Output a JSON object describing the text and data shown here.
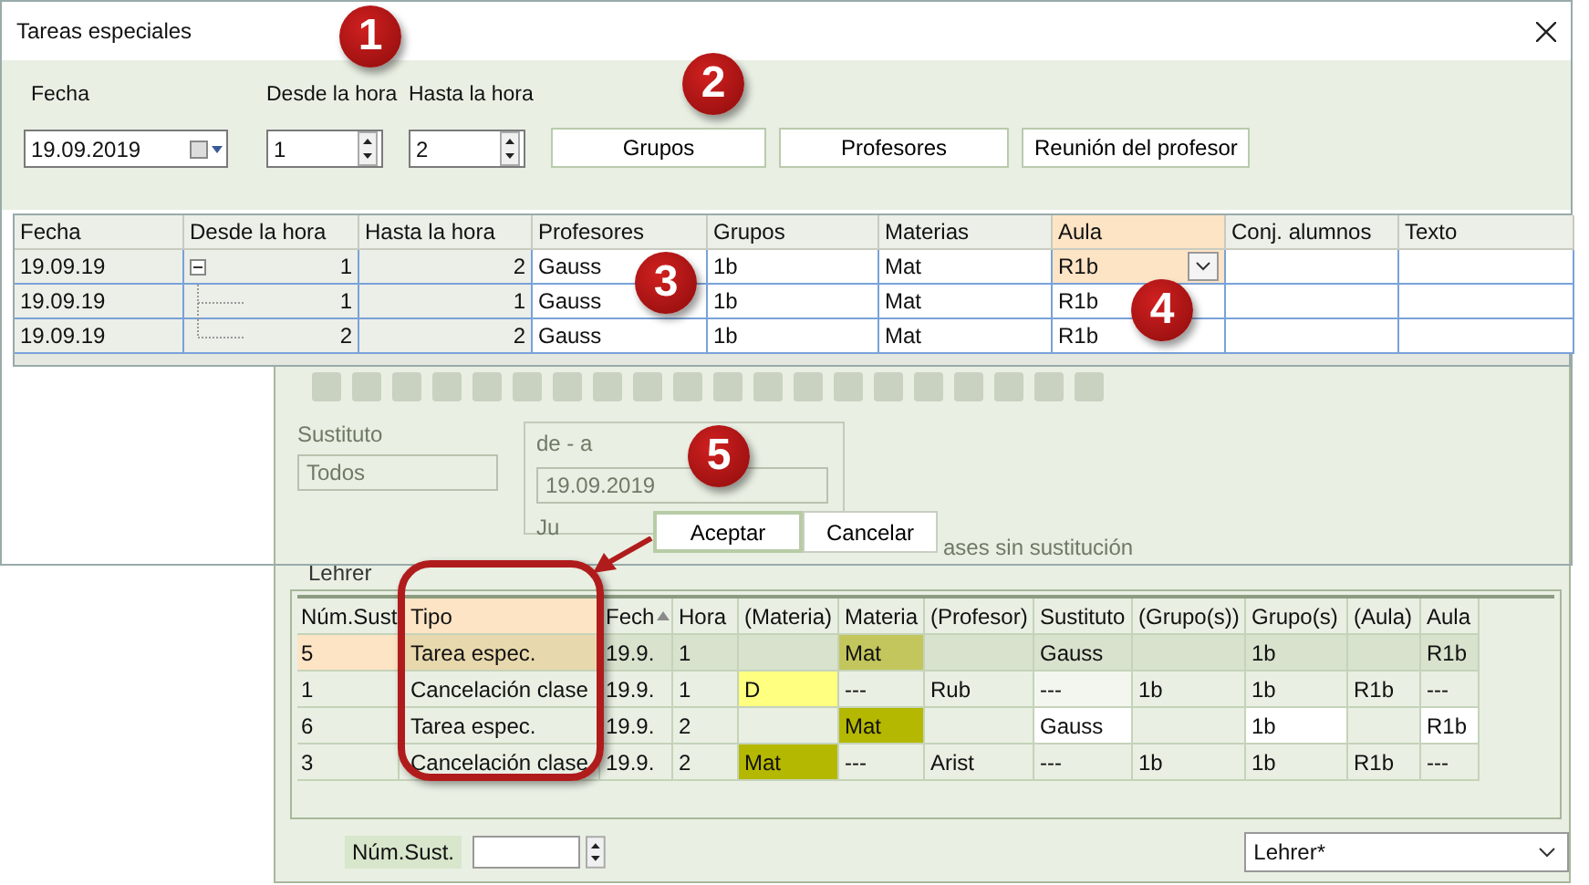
{
  "background_window": {
    "filter": {
      "substitute_label": "Sustituto",
      "substitute_value": "Todos",
      "range_label": "de - a",
      "range_from": "19.09.2019",
      "range_day": "Ju",
      "option_label": "ases sin sustitución"
    },
    "group_label": "Lehrer",
    "table": {
      "columns": [
        {
          "label": "Núm.Sust",
          "selected": false,
          "sorted": false
        },
        {
          "label": "Tipo",
          "selected": true,
          "sorted": false
        },
        {
          "label": "Fech",
          "selected": false,
          "sorted": true
        },
        {
          "label": "Hora",
          "selected": false,
          "sorted": false
        },
        {
          "label": "(Materia)",
          "selected": false,
          "sorted": false
        },
        {
          "label": "Materia",
          "selected": false,
          "sorted": false
        },
        {
          "label": "(Profesor)",
          "selected": false,
          "sorted": false
        },
        {
          "label": "Sustituto",
          "selected": false,
          "sorted": false
        },
        {
          "label": "(Grupo(s))",
          "selected": false,
          "sorted": false
        },
        {
          "label": "Grupo(s)",
          "selected": false,
          "sorted": false
        },
        {
          "label": "(Aula)",
          "selected": false,
          "sorted": false
        },
        {
          "label": "Aula",
          "selected": false,
          "sorted": false
        }
      ],
      "rows": [
        {
          "selected": true,
          "cells": [
            {
              "text": "5",
              "color": "#fde4c5"
            },
            {
              "text": "Tarea espec.",
              "color": "#e8d8ad"
            },
            {
              "text": "19.9."
            },
            {
              "text": "1"
            },
            {},
            {
              "text": "Mat",
              "color": "#c2c65c"
            },
            {},
            {
              "text": "Gauss"
            },
            {},
            {
              "text": "1b"
            },
            {},
            {
              "text": "R1b"
            }
          ]
        },
        {
          "selected": false,
          "cells": [
            {
              "text": "1"
            },
            {
              "text": "Cancelación clase"
            },
            {
              "text": "19.9."
            },
            {
              "text": "1"
            },
            {
              "text": "D",
              "color": "#ffff80"
            },
            {
              "text": "---"
            },
            {
              "text": "Rub"
            },
            {
              "text": "---",
              "color": "#f3f6ef"
            },
            {
              "text": "1b"
            },
            {
              "text": "1b"
            },
            {
              "text": "R1b"
            },
            {
              "text": "---"
            }
          ]
        },
        {
          "selected": false,
          "cells": [
            {
              "text": "6"
            },
            {
              "text": "Tarea espec."
            },
            {
              "text": "19.9."
            },
            {
              "text": "2"
            },
            {},
            {
              "text": "Mat",
              "color": "#b5b800"
            },
            {},
            {
              "text": "Gauss",
              "color": "#ffffff"
            },
            {},
            {
              "text": "1b",
              "color": "#ffffff"
            },
            {},
            {
              "text": "R1b",
              "color": "#ffffff"
            }
          ]
        },
        {
          "selected": false,
          "cells": [
            {
              "text": "3"
            },
            {
              "text": "Cancelación clase"
            },
            {
              "text": "19.9."
            },
            {
              "text": "2"
            },
            {
              "text": "Mat",
              "color": "#b5b800"
            },
            {
              "text": "---"
            },
            {
              "text": "Arist"
            },
            {
              "text": "---"
            },
            {
              "text": "1b"
            },
            {
              "text": "1b"
            },
            {
              "text": "R1b"
            },
            {
              "text": "---"
            }
          ]
        }
      ]
    },
    "count_label": "Núm.Sust.",
    "view_value": "Lehrer*"
  },
  "dialog": {
    "title": "Tareas especiales",
    "form": {
      "date_label": "Fecha",
      "date_value": "19.09.2019",
      "from_label": "Desde la hora",
      "from_value": "1",
      "to_label": "Hasta la hora",
      "to_value": "2"
    },
    "buttons": [
      {
        "label": "Grupos"
      },
      {
        "label": "Profesores"
      },
      {
        "label": "Reunión del profesor"
      }
    ],
    "grid": {
      "columns": [
        {
          "label": "Fecha",
          "shaded": true,
          "selected": false
        },
        {
          "label": "Desde la hora",
          "shaded": true,
          "selected": false
        },
        {
          "label": "Hasta la hora",
          "shaded": true,
          "selected": false
        },
        {
          "label": "Profesores",
          "shaded": false,
          "selected": false
        },
        {
          "label": "Grupos",
          "shaded": false,
          "selected": false
        },
        {
          "label": "Materias",
          "shaded": false,
          "selected": false
        },
        {
          "label": "Aula",
          "shaded": false,
          "selected": true
        },
        {
          "label": "Conj. alumnos",
          "shaded": false,
          "selected": false
        },
        {
          "label": "Texto",
          "shaded": false,
          "selected": false
        }
      ],
      "rows": [
        {
          "selected": true,
          "expanded": true,
          "cells": [
            "19.09.19",
            "1",
            "2",
            "Gauss",
            "1b",
            "Mat",
            "R1b"
          ],
          "children": [
            {
              "selected": false,
              "cells": [
                "19.09.19",
                "1",
                "1",
                "Gauss",
                "1b",
                "Mat",
                "R1b"
              ]
            },
            {
              "selected": false,
              "cells": [
                "19.09.19",
                "2",
                "2",
                "Gauss",
                "1b",
                "Mat",
                "R1b"
              ]
            }
          ]
        }
      ]
    },
    "actions": [
      {
        "label": "Aceptar",
        "default": true
      },
      {
        "label": "Cancelar",
        "default": false
      }
    ]
  },
  "callouts": [
    {
      "label": "1"
    },
    {
      "label": "2"
    },
    {
      "label": "3"
    },
    {
      "label": "4"
    },
    {
      "label": "5"
    }
  ]
}
